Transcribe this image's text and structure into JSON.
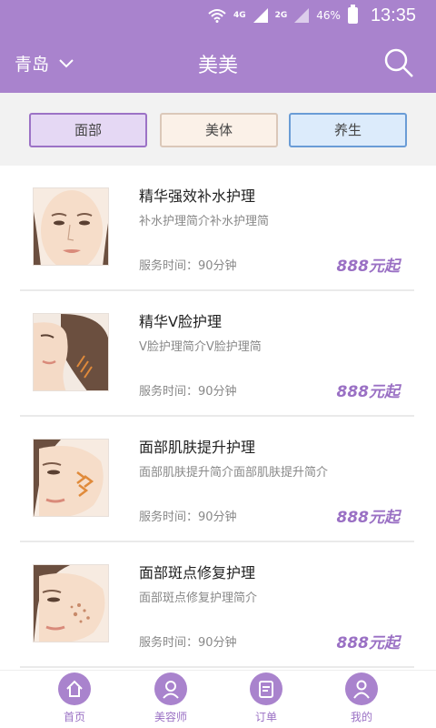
{
  "status_bar": {
    "signal": "4G",
    "signal2": "4G",
    "signal3": "2G",
    "battery": "46%",
    "time": "13:35"
  },
  "header": {
    "city": "青岛",
    "title": "美美"
  },
  "tabs": [
    {
      "label": "面部"
    },
    {
      "label": "美体"
    },
    {
      "label": "养生"
    }
  ],
  "services": [
    {
      "name": "精华强效补水护理",
      "desc": "补水护理简介补水护理简",
      "duration": "服务时间：90分钟",
      "price": "888元起"
    },
    {
      "name": "精华V脸护理",
      "desc": "V脸护理简介V脸护理简",
      "duration": "服务时间：90分钟",
      "price": "888元起"
    },
    {
      "name": "面部肌肤提升护理",
      "desc": "面部肌肤提升简介面部肌肤提升简介",
      "duration": "服务时间：90分钟",
      "price": "888元起"
    },
    {
      "name": "面部斑点修复护理",
      "desc": "面部斑点修复护理简介",
      "duration": "服务时间：90分钟",
      "price": "888元起"
    }
  ],
  "bottom_nav": [
    {
      "label": "首页"
    },
    {
      "label": "美容师"
    },
    {
      "label": "订单"
    },
    {
      "label": "我的"
    }
  ],
  "colors": {
    "brand": "#a983cd",
    "price": "#9a70c4"
  }
}
